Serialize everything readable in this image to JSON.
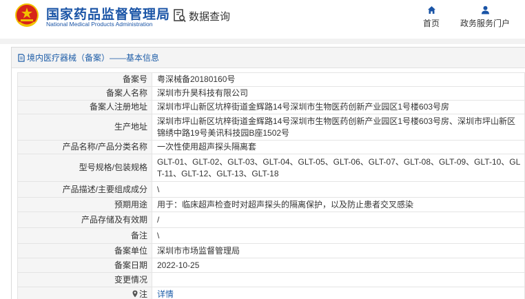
{
  "header": {
    "title_cn": "国家药品监督管理局",
    "title_en": "National Medical Products Administration",
    "query_label": "数据查询",
    "nav": [
      {
        "label": "首页",
        "icon": "home-icon"
      },
      {
        "label": "政务服务门户",
        "icon": "user-icon"
      }
    ]
  },
  "breadcrumb": "境内医疗器械（备案）——基本信息",
  "record": {
    "rows": [
      {
        "key": "备案号",
        "value": "粤深械备20180160号"
      },
      {
        "key": "备案人名称",
        "value": "深圳市升昊科技有限公司"
      },
      {
        "key": "备案人注册地址",
        "value": "深圳市坪山新区坑梓街道金辉路14号深圳市生物医药创新产业园区1号楼603号房"
      },
      {
        "key": "生产地址",
        "value": "深圳市坪山新区坑梓街道金辉路14号深圳市生物医药创新产业园区1号楼603号房、深圳市坪山新区锦绣中路19号美讯科技园B座1502号"
      },
      {
        "key": "产品名称/产品分类名称",
        "value": "一次性使用超声探头隔离套"
      },
      {
        "key": "型号规格/包装规格",
        "value": "GLT-01、GLT-02、GLT-03、GLT-04、GLT-05、GLT-06、GLT-07、GLT-08、GLT-09、GLT-10、GLT-11、GLT-12、GLT-13、GLT-18"
      },
      {
        "key": "产品描述/主要组成成分",
        "value": "\\"
      },
      {
        "key": "预期用途",
        "value": "用于：临床超声检查时对超声探头的隔离保护，以及防止患者交叉感染"
      },
      {
        "key": "产品存储及有效期",
        "value": "/"
      },
      {
        "key": "备注",
        "value": "\\"
      },
      {
        "key": "备案单位",
        "value": "深圳市市场监督管理局"
      },
      {
        "key": "备案日期",
        "value": "2022-10-25"
      },
      {
        "key": "变更情况",
        "value": ""
      },
      {
        "key": "注",
        "value": "详情"
      }
    ]
  },
  "colors": {
    "brand_blue": "#1a54a6",
    "link_blue": "#1f5ea8",
    "emblem_red": "#d7251b",
    "emblem_gold": "#f2c300"
  }
}
